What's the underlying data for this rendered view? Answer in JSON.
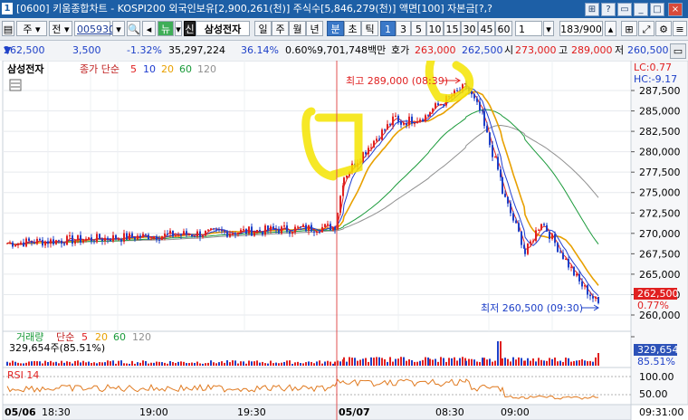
{
  "titlebar": {
    "app_icon": "1",
    "text": "[0600] 키움종합차트 - KOSPI200 외국인보유[2,900,261(천)] 주식수[5,846,279(천)] 액면[100] 자본금[?,?"
  },
  "toolbar": {
    "market": "주",
    "period_type": "전",
    "code": "005930",
    "shin": "신",
    "stock_name": "삼성전자",
    "periods": [
      "일",
      "주",
      "월",
      "년"
    ],
    "minute_tick": [
      "분",
      "초",
      "틱"
    ],
    "intervals": [
      "1",
      "3",
      "5",
      "10",
      "15",
      "30",
      "45",
      "60"
    ],
    "interval_input": "1",
    "count": "183/900"
  },
  "quote": {
    "price": "262,500",
    "change": "3,500",
    "change_pct": "-1.32%",
    "volume": "35,297,224",
    "vol_ratio": "36.14%",
    "turnover_pct": "0.60%",
    "amount": "9,701,748백만",
    "ask_label": "호가",
    "ask1": "263,000",
    "bid1": "262,500",
    "open_label": "시",
    "open": "273,000",
    "high_label": "고",
    "high": "289,000",
    "low_label": "저",
    "low": "260,500"
  },
  "price_panel": {
    "stock_name": "삼성전자",
    "ma_label": "종가 단순",
    "ma_periods": [
      "5",
      "10",
      "20",
      "60",
      "120"
    ],
    "ma_colors": [
      "#e02020",
      "#1e3cd0",
      "#e8a000",
      "#1a9a3a",
      "#909090"
    ],
    "lc": "LC:0.77",
    "hc": "HC:-9.17",
    "max_label": "최고 289,000 (08:39)",
    "min_label": "최저 260,500 (09:30)",
    "last_price_tag": "262,500",
    "last_pct_tag": "0.77%",
    "y_ticks": [
      "287,500",
      "285,000",
      "282,500",
      "280,000",
      "277,500",
      "275,000",
      "272,500",
      "270,000",
      "267,500",
      "265,000",
      "262,500",
      "260,000"
    ]
  },
  "volume_panel": {
    "label": "거래량",
    "ma_label": "단순",
    "ma_periods": [
      "5",
      "20",
      "60",
      "120"
    ],
    "value_text": "329,654주(85.51%)",
    "tag_value": "329,654",
    "tag_pct": "85.51%"
  },
  "rsi_panel": {
    "label": "RSI 14",
    "y_ticks": [
      "100.00",
      "50.00"
    ]
  },
  "time_axis": [
    "05/06",
    "18:30",
    "19:00",
    "19:30",
    "05/07",
    "08:30",
    "09:00",
    "09:31:00"
  ]
}
